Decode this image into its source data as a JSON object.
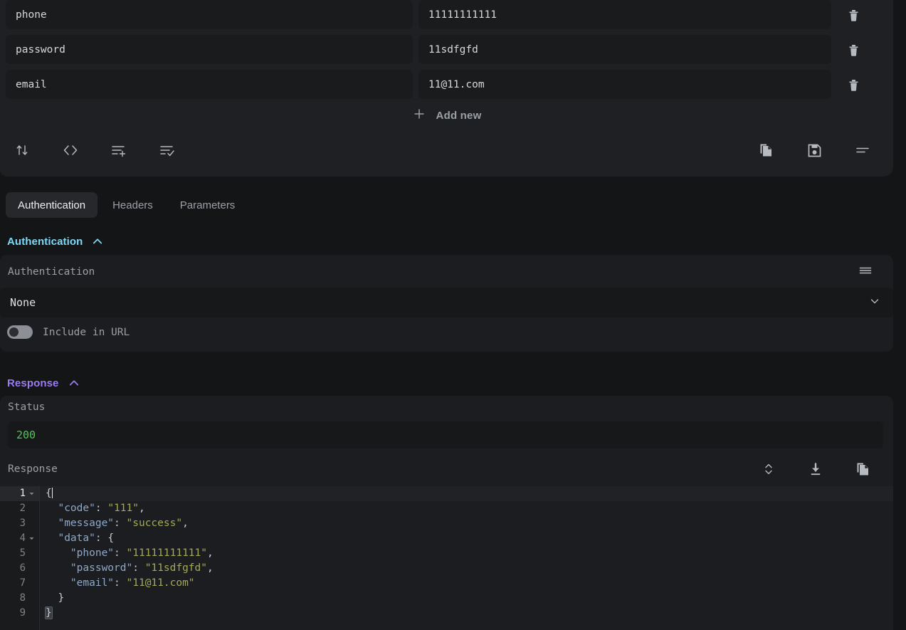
{
  "body_editor": {
    "rows": [
      {
        "key": "phone",
        "value": "11111111111",
        "delete_icon": "trash-icon"
      },
      {
        "key": "password",
        "value": "11sdfgfd",
        "delete_icon": "trash-icon"
      },
      {
        "key": "email",
        "value": "11@11.com",
        "delete_icon": "trash-icon"
      }
    ],
    "add_new_label": "Add new",
    "add_new_icon": "plus-icon",
    "toolbar_left": [
      {
        "icon": "sort-arrows-icon",
        "name": "sort-rows-button"
      },
      {
        "icon": "code-brackets-icon",
        "name": "view-raw-code-button"
      },
      {
        "icon": "list-plus-icon",
        "name": "add-row-button"
      },
      {
        "icon": "list-check-icon",
        "name": "toggle-all-rows-button"
      }
    ],
    "toolbar_right": [
      {
        "icon": "copy-icon",
        "name": "copy-body-button"
      },
      {
        "icon": "save-floppy-icon",
        "name": "save-body-button"
      },
      {
        "icon": "lines-icon",
        "name": "body-options-button"
      }
    ]
  },
  "tabs": [
    {
      "label": "Authentication",
      "active": true
    },
    {
      "label": "Headers",
      "active": false
    },
    {
      "label": "Parameters",
      "active": false
    }
  ],
  "authentication": {
    "section_title": "Authentication",
    "collapse_icon": "chevron-up-icon",
    "field_label": "Authentication",
    "options_icon": "lines-icon",
    "selected_option": "None",
    "select_caret_icon": "chevron-down-icon",
    "options": [
      "None"
    ],
    "include_in_url_label": "Include in URL",
    "include_in_url_enabled": false
  },
  "response": {
    "section_title": "Response",
    "collapse_icon": "chevron-up-icon",
    "status_label": "Status",
    "status_code": "200",
    "status_color": "#57c45a",
    "response_label": "Response",
    "icons": [
      {
        "icon": "expand-collapse-icon",
        "name": "wrap-lines-button"
      },
      {
        "icon": "download-icon",
        "name": "download-response-button"
      },
      {
        "icon": "copy-icon",
        "name": "copy-response-button"
      }
    ],
    "code": {
      "language": "json",
      "active_line": 1,
      "lines": [
        {
          "n": 1,
          "fold": true,
          "indent": 0,
          "tokens": [
            {
              "t": "punc",
              "v": "{"
            }
          ]
        },
        {
          "n": 2,
          "fold": false,
          "indent": 1,
          "tokens": [
            {
              "t": "key",
              "v": "\"code\""
            },
            {
              "t": "punc",
              "v": ": "
            },
            {
              "t": "str",
              "v": "\"111\""
            },
            {
              "t": "punc",
              "v": ","
            }
          ]
        },
        {
          "n": 3,
          "fold": false,
          "indent": 1,
          "tokens": [
            {
              "t": "key",
              "v": "\"message\""
            },
            {
              "t": "punc",
              "v": ": "
            },
            {
              "t": "str",
              "v": "\"success\""
            },
            {
              "t": "punc",
              "v": ","
            }
          ]
        },
        {
          "n": 4,
          "fold": true,
          "indent": 1,
          "tokens": [
            {
              "t": "key",
              "v": "\"data\""
            },
            {
              "t": "punc",
              "v": ": {"
            }
          ]
        },
        {
          "n": 5,
          "fold": false,
          "indent": 2,
          "tokens": [
            {
              "t": "key",
              "v": "\"phone\""
            },
            {
              "t": "punc",
              "v": ": "
            },
            {
              "t": "str",
              "v": "\"11111111111\""
            },
            {
              "t": "punc",
              "v": ","
            }
          ]
        },
        {
          "n": 6,
          "fold": false,
          "indent": 2,
          "tokens": [
            {
              "t": "key",
              "v": "\"password\""
            },
            {
              "t": "punc",
              "v": ": "
            },
            {
              "t": "str",
              "v": "\"11sdfgfd\""
            },
            {
              "t": "punc",
              "v": ","
            }
          ]
        },
        {
          "n": 7,
          "fold": false,
          "indent": 2,
          "tokens": [
            {
              "t": "key",
              "v": "\"email\""
            },
            {
              "t": "punc",
              "v": ": "
            },
            {
              "t": "str",
              "v": "\"11@11.com\""
            }
          ]
        },
        {
          "n": 8,
          "fold": false,
          "indent": 1,
          "tokens": [
            {
              "t": "punc",
              "v": "}"
            }
          ]
        },
        {
          "n": 9,
          "fold": false,
          "indent": 0,
          "tokens": [
            {
              "t": "punc-hl",
              "v": "}"
            }
          ]
        }
      ]
    }
  },
  "theme": {
    "page_bg": "#141517",
    "card_bg": "#1f2023",
    "panel_bg": "#1c1d20",
    "field_bg": "#1a1b1d",
    "auth_accent": "#7fd8f5",
    "response_accent": "#9b7bf0",
    "status_green": "#57c45a",
    "icon_gray": "#9aa0a6"
  }
}
